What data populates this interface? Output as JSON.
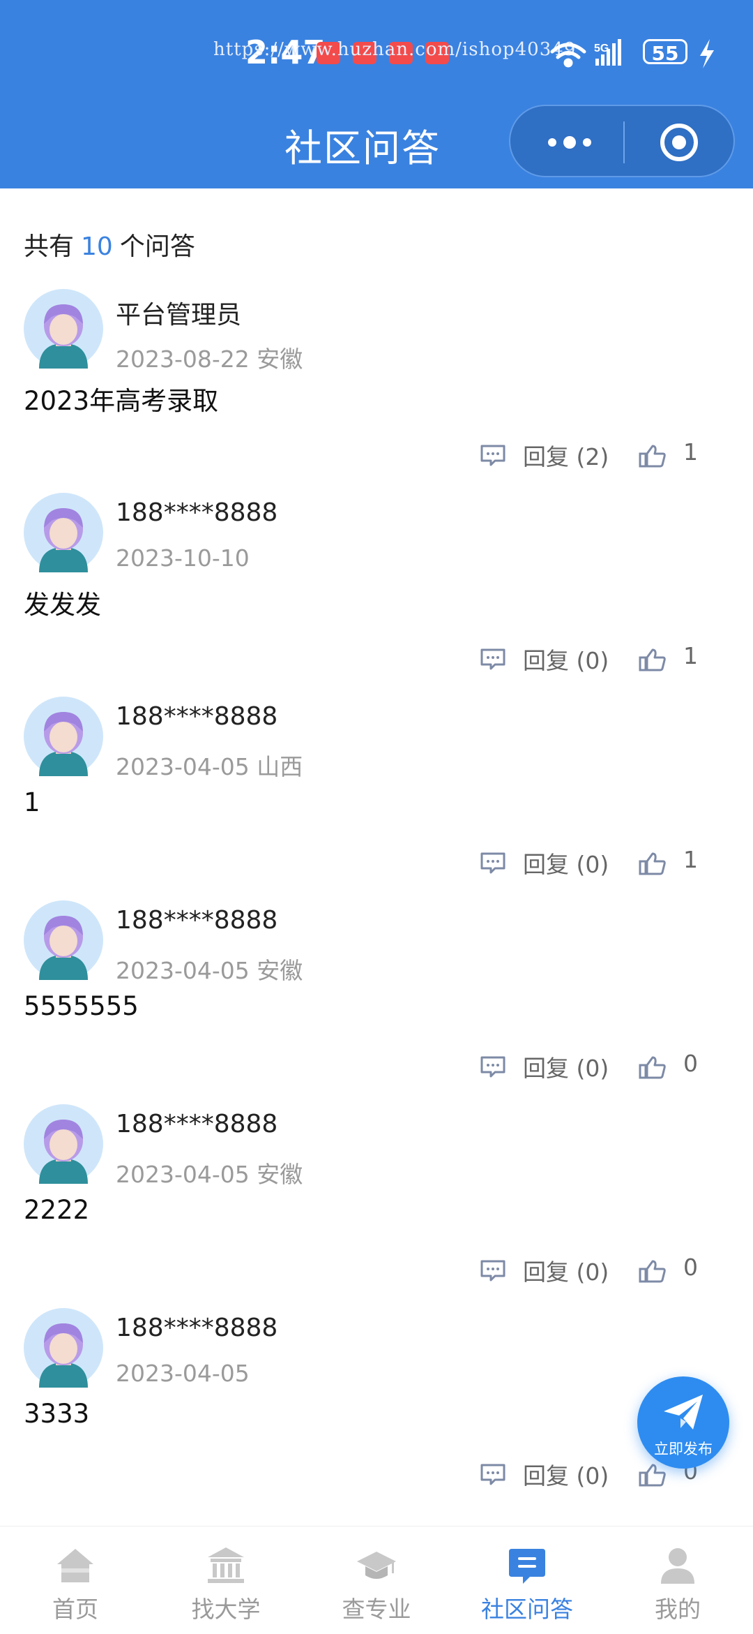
{
  "status_bar": {
    "time": "2:47",
    "watermark": "https://www.huzhan.com/ishop40349",
    "battery": "55"
  },
  "nav": {
    "title": "社区问答"
  },
  "summary": {
    "prefix": "共有",
    "count": "10",
    "suffix": "个问答"
  },
  "posts": [
    {
      "user": "平台管理员",
      "date": "2023-08-22",
      "region": "安徽",
      "content": "2023年高考录取",
      "reply": "回复 (2)",
      "likes": "1"
    },
    {
      "user": "188****8888",
      "date": "2023-10-10",
      "region": "",
      "content": "发发发",
      "reply": "回复 (0)",
      "likes": "1"
    },
    {
      "user": "188****8888",
      "date": "2023-04-05",
      "region": "山西",
      "content": "1",
      "reply": "回复 (0)",
      "likes": "1"
    },
    {
      "user": "188****8888",
      "date": "2023-04-05",
      "region": "安徽",
      "content": "5555555",
      "reply": "回复 (0)",
      "likes": "0"
    },
    {
      "user": "188****8888",
      "date": "2023-04-05",
      "region": "安徽",
      "content": "2222",
      "reply": "回复 (0)",
      "likes": "0"
    },
    {
      "user": "188****8888",
      "date": "2023-04-05",
      "region": "",
      "content": "3333",
      "reply": "回复 (0)",
      "likes": "0"
    }
  ],
  "fab": {
    "label": "立即发布"
  },
  "tabbar": {
    "items": [
      {
        "label": "首页",
        "icon": "home-icon"
      },
      {
        "label": "找大学",
        "icon": "university-icon"
      },
      {
        "label": "查专业",
        "icon": "graduation-cap-icon"
      },
      {
        "label": "社区问答",
        "icon": "chat-icon",
        "active": true
      },
      {
        "label": "我的",
        "icon": "user-icon"
      }
    ]
  },
  "colors": {
    "primary": "#3a82e0",
    "muted": "#9a9a9a"
  }
}
